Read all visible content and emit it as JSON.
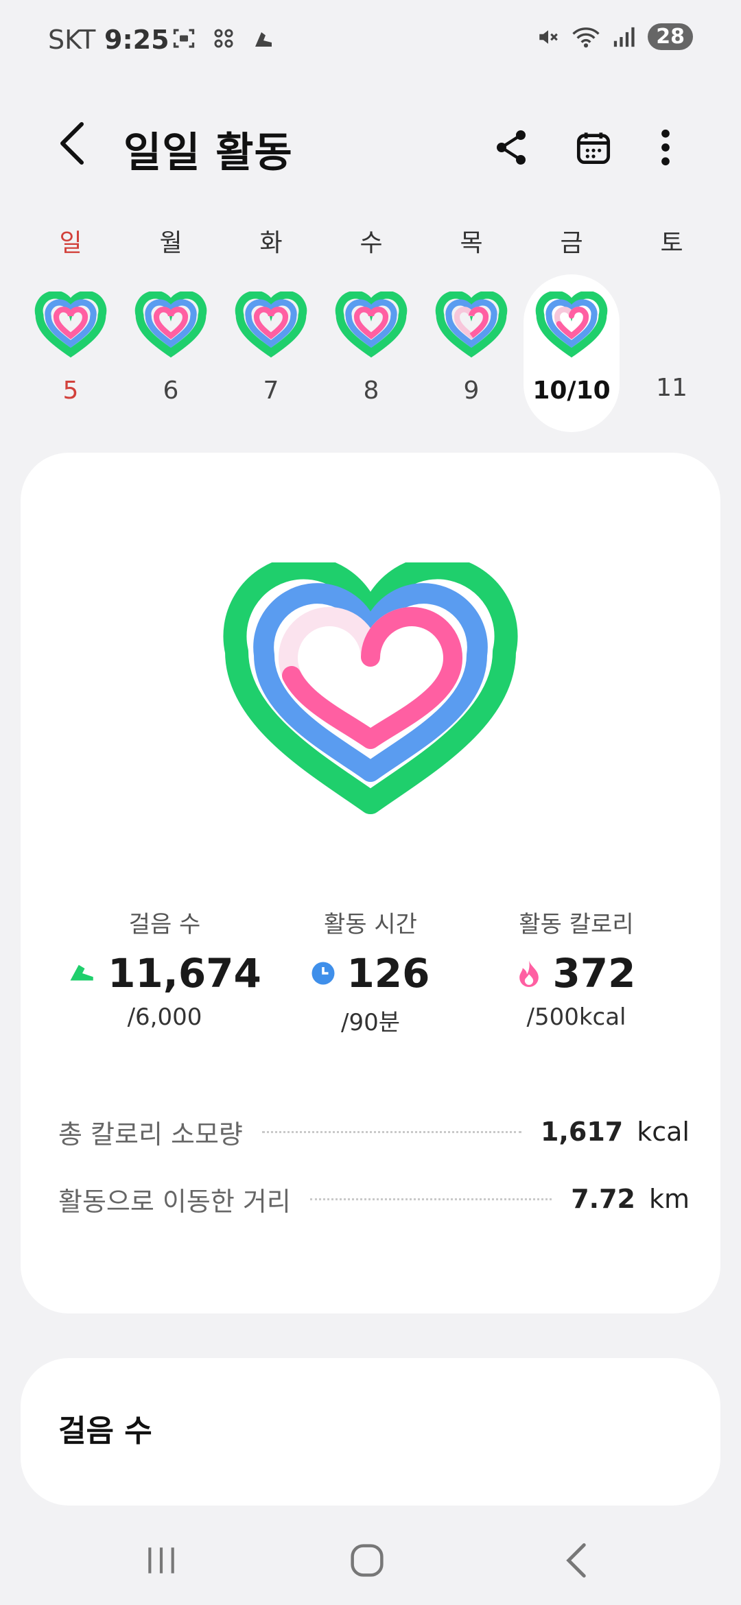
{
  "status_bar": {
    "carrier": "SKT",
    "time": "9:25",
    "battery": "28"
  },
  "app_bar": {
    "title": "일일 활동"
  },
  "week": {
    "days": [
      {
        "label": "일",
        "date": "5"
      },
      {
        "label": "월",
        "date": "6"
      },
      {
        "label": "화",
        "date": "7"
      },
      {
        "label": "수",
        "date": "8"
      },
      {
        "label": "목",
        "date": "9"
      },
      {
        "label": "금",
        "date": "10/10"
      },
      {
        "label": "토",
        "date": "11"
      }
    ]
  },
  "summary": {
    "steps": {
      "label": "걸음 수",
      "value": "11,674",
      "goal": "/6,000"
    },
    "active_time": {
      "label": "활동 시간",
      "value": "126",
      "goal": "/90분"
    },
    "active_calories": {
      "label": "활동 칼로리",
      "value": "372",
      "goal": "/500kcal"
    },
    "total_calories": {
      "label": "총 칼로리 소모량",
      "value": "1,617",
      "unit": "kcal"
    },
    "distance": {
      "label": "활동으로 이동한 거리",
      "value": "7.72",
      "unit": "km"
    },
    "ring_fill": {
      "steps": 1.0,
      "active_time": 1.0,
      "active_calories": 0.744
    }
  },
  "steps_card": {
    "title": "걸음 수"
  },
  "colors": {
    "steps_ring": "#1fcf6c",
    "time_ring": "#5a9cf0",
    "calorie_ring": "#ff5fa2",
    "sunday": "#d2413b"
  }
}
